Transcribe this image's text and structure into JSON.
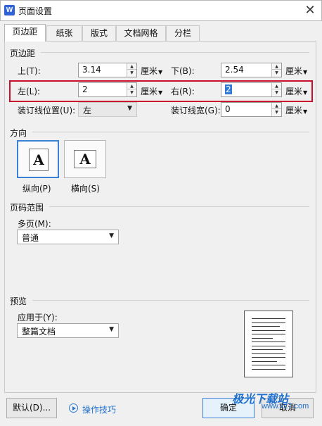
{
  "window": {
    "title": "页面设置",
    "app_icon_letter": "W",
    "close_glyph": "✕"
  },
  "tabs": [
    {
      "label": "页边距",
      "active": true
    },
    {
      "label": "纸张"
    },
    {
      "label": "版式"
    },
    {
      "label": "文档网格"
    },
    {
      "label": "分栏"
    }
  ],
  "margins": {
    "section_title": "页边距",
    "top": {
      "label": "上(T):",
      "value": "3.14",
      "unit": "厘米"
    },
    "bottom": {
      "label": "下(B):",
      "value": "2.54",
      "unit": "厘米"
    },
    "left": {
      "label": "左(L):",
      "value": "2",
      "unit": "厘米"
    },
    "right": {
      "label": "右(R):",
      "value": "2",
      "unit": "厘米"
    },
    "gutter_pos": {
      "label": "装订线位置(U):",
      "value": "左"
    },
    "gutter": {
      "label": "装订线宽(G):",
      "value": "0",
      "unit": "厘米"
    }
  },
  "orientation": {
    "section_title": "方向",
    "portrait": {
      "label": "纵向(P)",
      "glyph": "A"
    },
    "landscape": {
      "label": "横向(S)",
      "glyph": "A"
    }
  },
  "page_range": {
    "section_title": "页码范围",
    "multi_label": "多页(M):",
    "multi_value": "普通"
  },
  "preview": {
    "section_title": "预览",
    "apply_label": "应用于(Y):",
    "apply_value": "整篇文档"
  },
  "footer": {
    "default_button": "默认(D)...",
    "tips_link": "操作技巧",
    "ok_button": "确定",
    "cancel_button": "取消"
  },
  "watermark": {
    "text": "极光下载站",
    "sub": "www.xz7.com"
  },
  "colors": {
    "highlight": "#c8102e",
    "accent": "#2f62d6"
  }
}
